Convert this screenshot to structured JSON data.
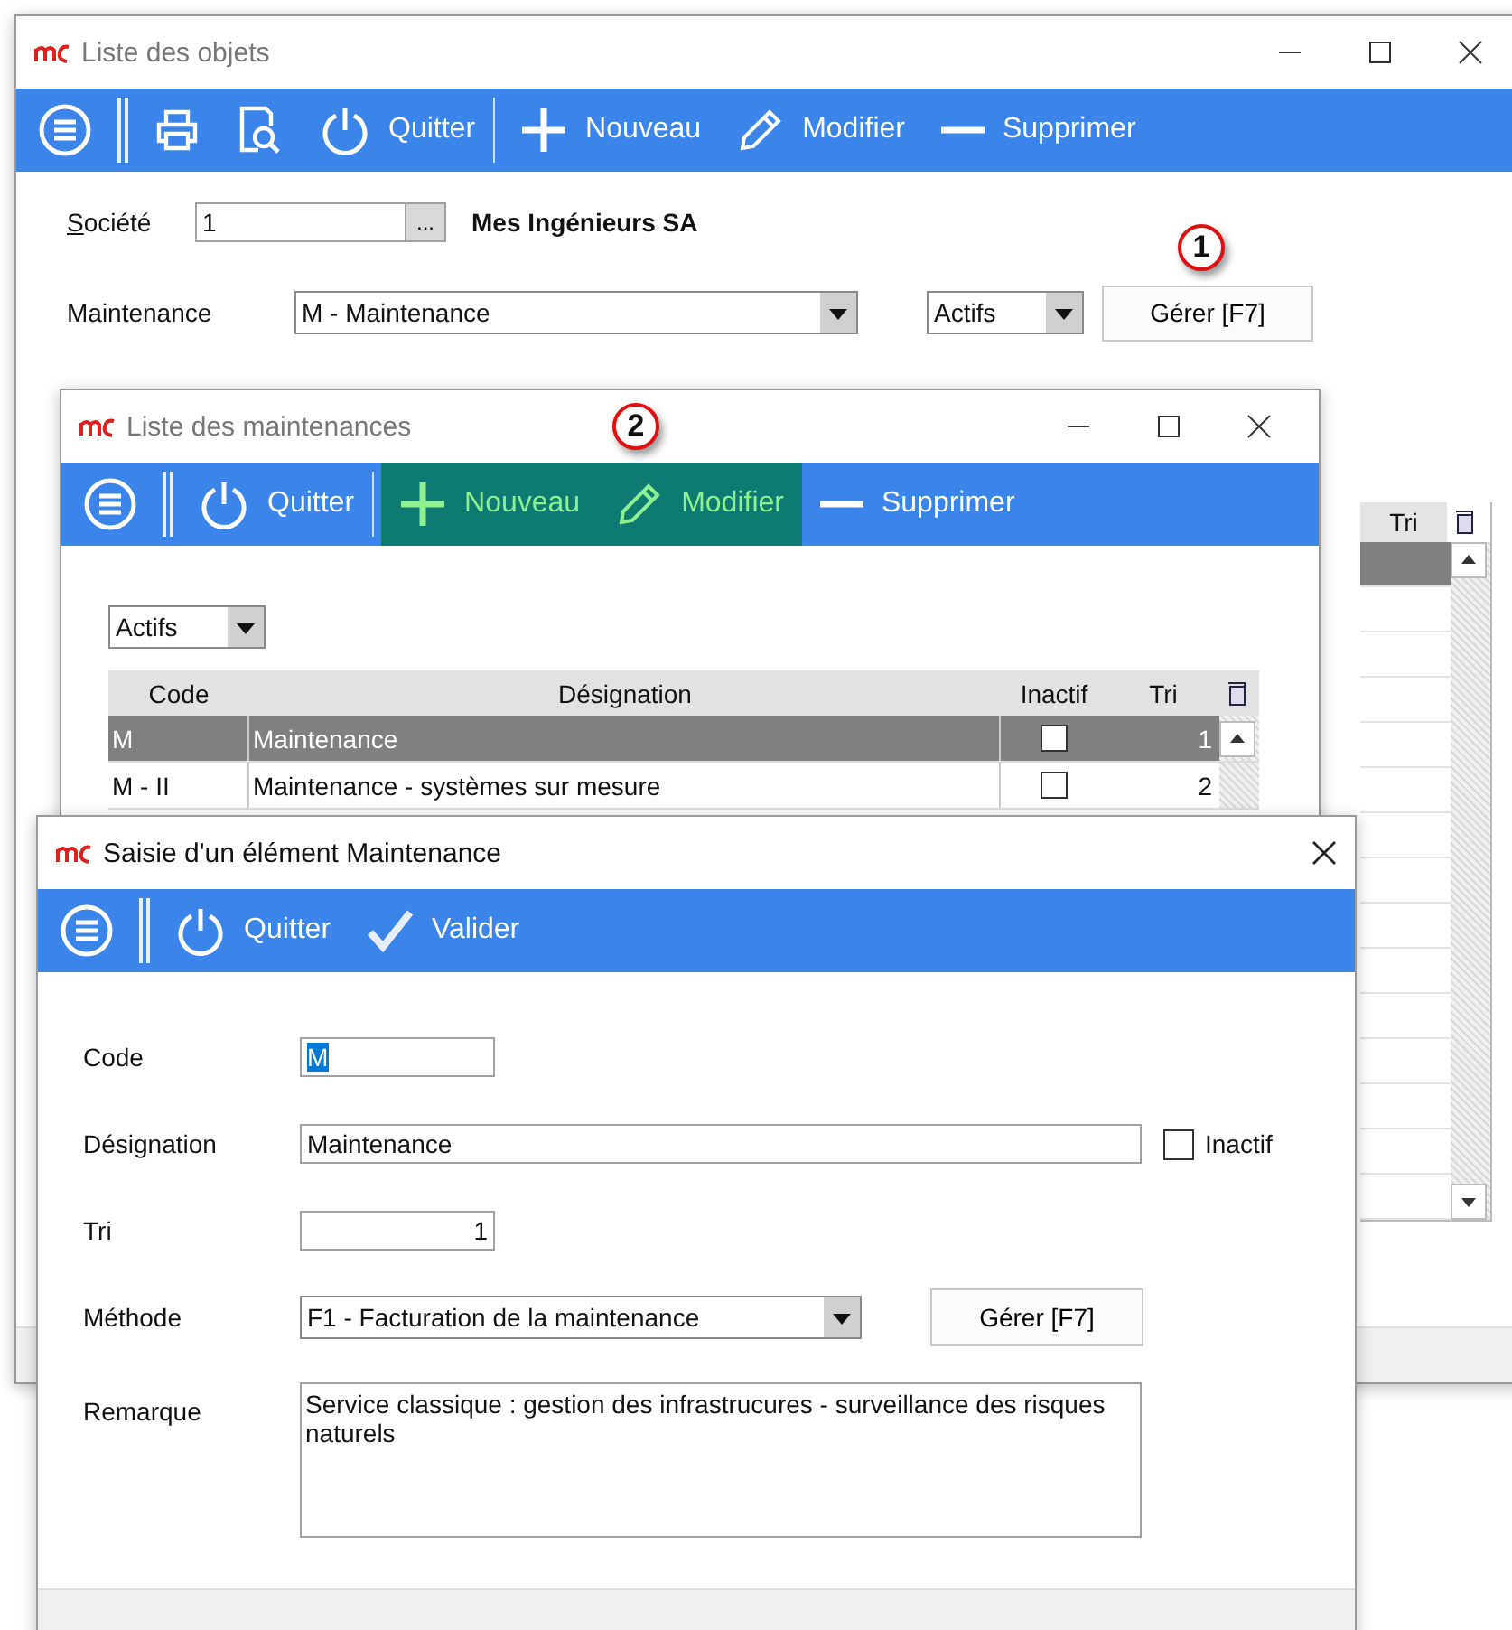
{
  "main_window": {
    "title": "Liste des objets",
    "toolbar": [
      {
        "kind": "menu"
      },
      {
        "kind": "print"
      },
      {
        "kind": "preview"
      },
      {
        "kind": "quit",
        "label": "Quitter"
      },
      {
        "kind": "new",
        "label": "Nouveau",
        "group_start": true
      },
      {
        "kind": "edit",
        "label": "Modifier"
      },
      {
        "kind": "delete",
        "label": "Supprimer"
      }
    ],
    "company": {
      "label": "Société",
      "value": "1",
      "browse": "...",
      "name": "Mes Ingénieurs SA"
    },
    "maintenance": {
      "label": "Maintenance",
      "value": "M - Maintenance"
    },
    "filter": "Actifs",
    "manage_button": "Gérer [F7]",
    "table": {
      "columns": [
        "Tri"
      ],
      "rows": [
        {
          "selected": true
        },
        {
          "selected": false
        },
        {
          "selected": false
        },
        {
          "selected": false
        },
        {
          "selected": false
        },
        {
          "selected": false
        },
        {
          "selected": false
        },
        {
          "selected": false
        },
        {
          "selected": false
        },
        {
          "selected": false
        },
        {
          "selected": false
        },
        {
          "selected": false
        },
        {
          "selected": false
        },
        {
          "selected": false
        },
        {
          "selected": false
        }
      ]
    }
  },
  "maintenance_window": {
    "title": "Liste des maintenances",
    "toolbar": [
      {
        "kind": "menu"
      },
      {
        "kind": "quit",
        "label": "Quitter"
      },
      {
        "kind": "new",
        "label": "Nouveau",
        "group_start": true,
        "highlighted": true
      },
      {
        "kind": "edit",
        "label": "Modifier",
        "highlighted": true
      },
      {
        "kind": "delete",
        "label": "Supprimer",
        "highlighted": false
      }
    ],
    "filter": "Actifs",
    "table": {
      "columns": [
        "Code",
        "Désignation",
        "Inactif",
        "Tri"
      ],
      "rows": [
        {
          "code": "M",
          "designation": "Maintenance",
          "inactive": false,
          "tri": "1",
          "selected": true
        },
        {
          "code": "M - II",
          "designation": "Maintenance - systèmes sur mesure",
          "inactive": false,
          "tri": "2",
          "selected": false
        }
      ]
    }
  },
  "edit_dialog": {
    "title": "Saisie d'un élément Maintenance",
    "toolbar": [
      {
        "kind": "menu"
      },
      {
        "kind": "quit",
        "label": "Quitter"
      },
      {
        "kind": "validate",
        "label": "Valider"
      }
    ],
    "code": {
      "label": "Code",
      "value": "M"
    },
    "designation": {
      "label": "Désignation",
      "value": "Maintenance"
    },
    "inactive": {
      "label": "Inactif",
      "checked": false
    },
    "tri": {
      "label": "Tri",
      "value": "1"
    },
    "method": {
      "label": "Méthode",
      "value": "F1 - Facturation de la maintenance",
      "button": "Gérer [F7]"
    },
    "remark": {
      "label": "Remarque",
      "value": "Service classique : gestion des infrastrucures - surveillance des risques naturels"
    }
  },
  "callouts": [
    "1",
    "2"
  ]
}
